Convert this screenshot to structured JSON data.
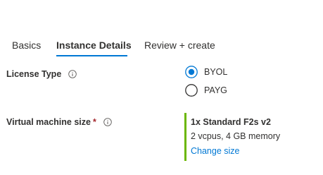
{
  "tabs": [
    {
      "label": "Basics",
      "active": false
    },
    {
      "label": "Instance Details",
      "active": true
    },
    {
      "label": "Review + create",
      "active": false
    }
  ],
  "fields": {
    "license_type": {
      "label": "License Type",
      "info_icon": "info-icon",
      "options": [
        {
          "label": "BYOL",
          "selected": true
        },
        {
          "label": "PAYG",
          "selected": false
        }
      ]
    },
    "vm_size": {
      "label": "Virtual machine size",
      "required_marker": "*",
      "info_icon": "info-icon",
      "selection": {
        "name": "1x Standard F2s v2",
        "spec": "2 vcpus, 4 GB memory",
        "change_link": "Change size"
      }
    }
  },
  "colors": {
    "accent": "#0078d4",
    "text": "#323130",
    "required": "#a4262c",
    "selection_bar": "#6bb700"
  }
}
